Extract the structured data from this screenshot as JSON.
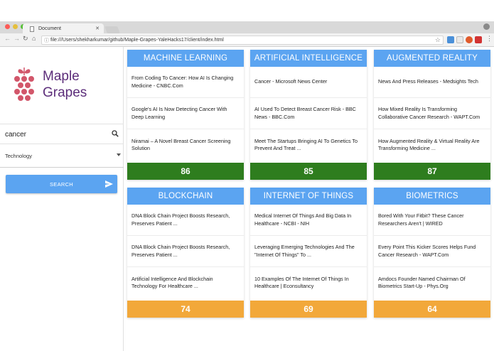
{
  "browser": {
    "tab_title": "Document",
    "url": "file:///Users/shekharkumar/github/Maple-Grapes-YaleHacks17/client/index.html"
  },
  "sidebar": {
    "brand_line1": "Maple",
    "brand_line2": "Grapes",
    "search_value": "cancer",
    "category": "Technology",
    "search_button": "SEARCH"
  },
  "colors": {
    "header": "#5ba4f1",
    "score_high": "#2e7d1e",
    "score_mid": "#f2a83a",
    "brand": "#5c2d7a",
    "logo": "#d2566a"
  },
  "cards": [
    {
      "title": "MACHINE LEARNING",
      "score": "86",
      "level": "high",
      "articles": [
        "From Coding To Cancer: How AI Is Changing Medicine - CNBC.Com",
        "Google's AI Is Now Detecting Cancer With Deep Learning",
        "Niramai – A Novel Breast Cancer Screening Solution"
      ]
    },
    {
      "title": "ARTIFICIAL INTELLIGENCE",
      "score": "85",
      "level": "high",
      "articles": [
        "Cancer - Microsoft News Center",
        "AI Used To Detect Breast Cancer Risk - BBC News - BBC.Com",
        "Meet The Startups Bringing AI To Genetics To Prevent And Treat ..."
      ]
    },
    {
      "title": "AUGMENTED REALITY",
      "score": "87",
      "level": "high",
      "articles": [
        "News And Press Releases - Medsights Tech",
        "How Mixed Reality Is Transforming Collaborative Cancer Research - WAPT.Com",
        "How Augmented Reality & Virtual Reality Are Transforming Medicine ..."
      ]
    },
    {
      "title": "BLOCKCHAIN",
      "score": "74",
      "level": "mid",
      "articles": [
        "DNA Block Chain Project Boosts Research, Preserves Patient ...",
        "DNA Block Chain Project Boosts Research, Preserves Patient ...",
        "Artificial Intelligence And Blockchain Technology For Healthcare ..."
      ]
    },
    {
      "title": "INTERNET OF THINGS",
      "score": "69",
      "level": "mid",
      "articles": [
        "Medical Internet Of Things And Big Data In Healthcare - NCBI - NIH",
        "Leveraging Emerging Technologies And The \"Internet Of Things\" To ...",
        "10 Examples Of The Internet Of Things In Healthcare | Econsultancy"
      ]
    },
    {
      "title": "BIOMETRICS",
      "score": "64",
      "level": "mid",
      "articles": [
        "Bored With Your Fitbit? These Cancer Researchers Aren't | WIRED",
        "Every Point This Kicker Scores Helps Fund Cancer Research - WAPT.Com",
        "Amdocs Founder Named Chairman Of Biometrics Start-Up - Phys.Org"
      ]
    }
  ]
}
